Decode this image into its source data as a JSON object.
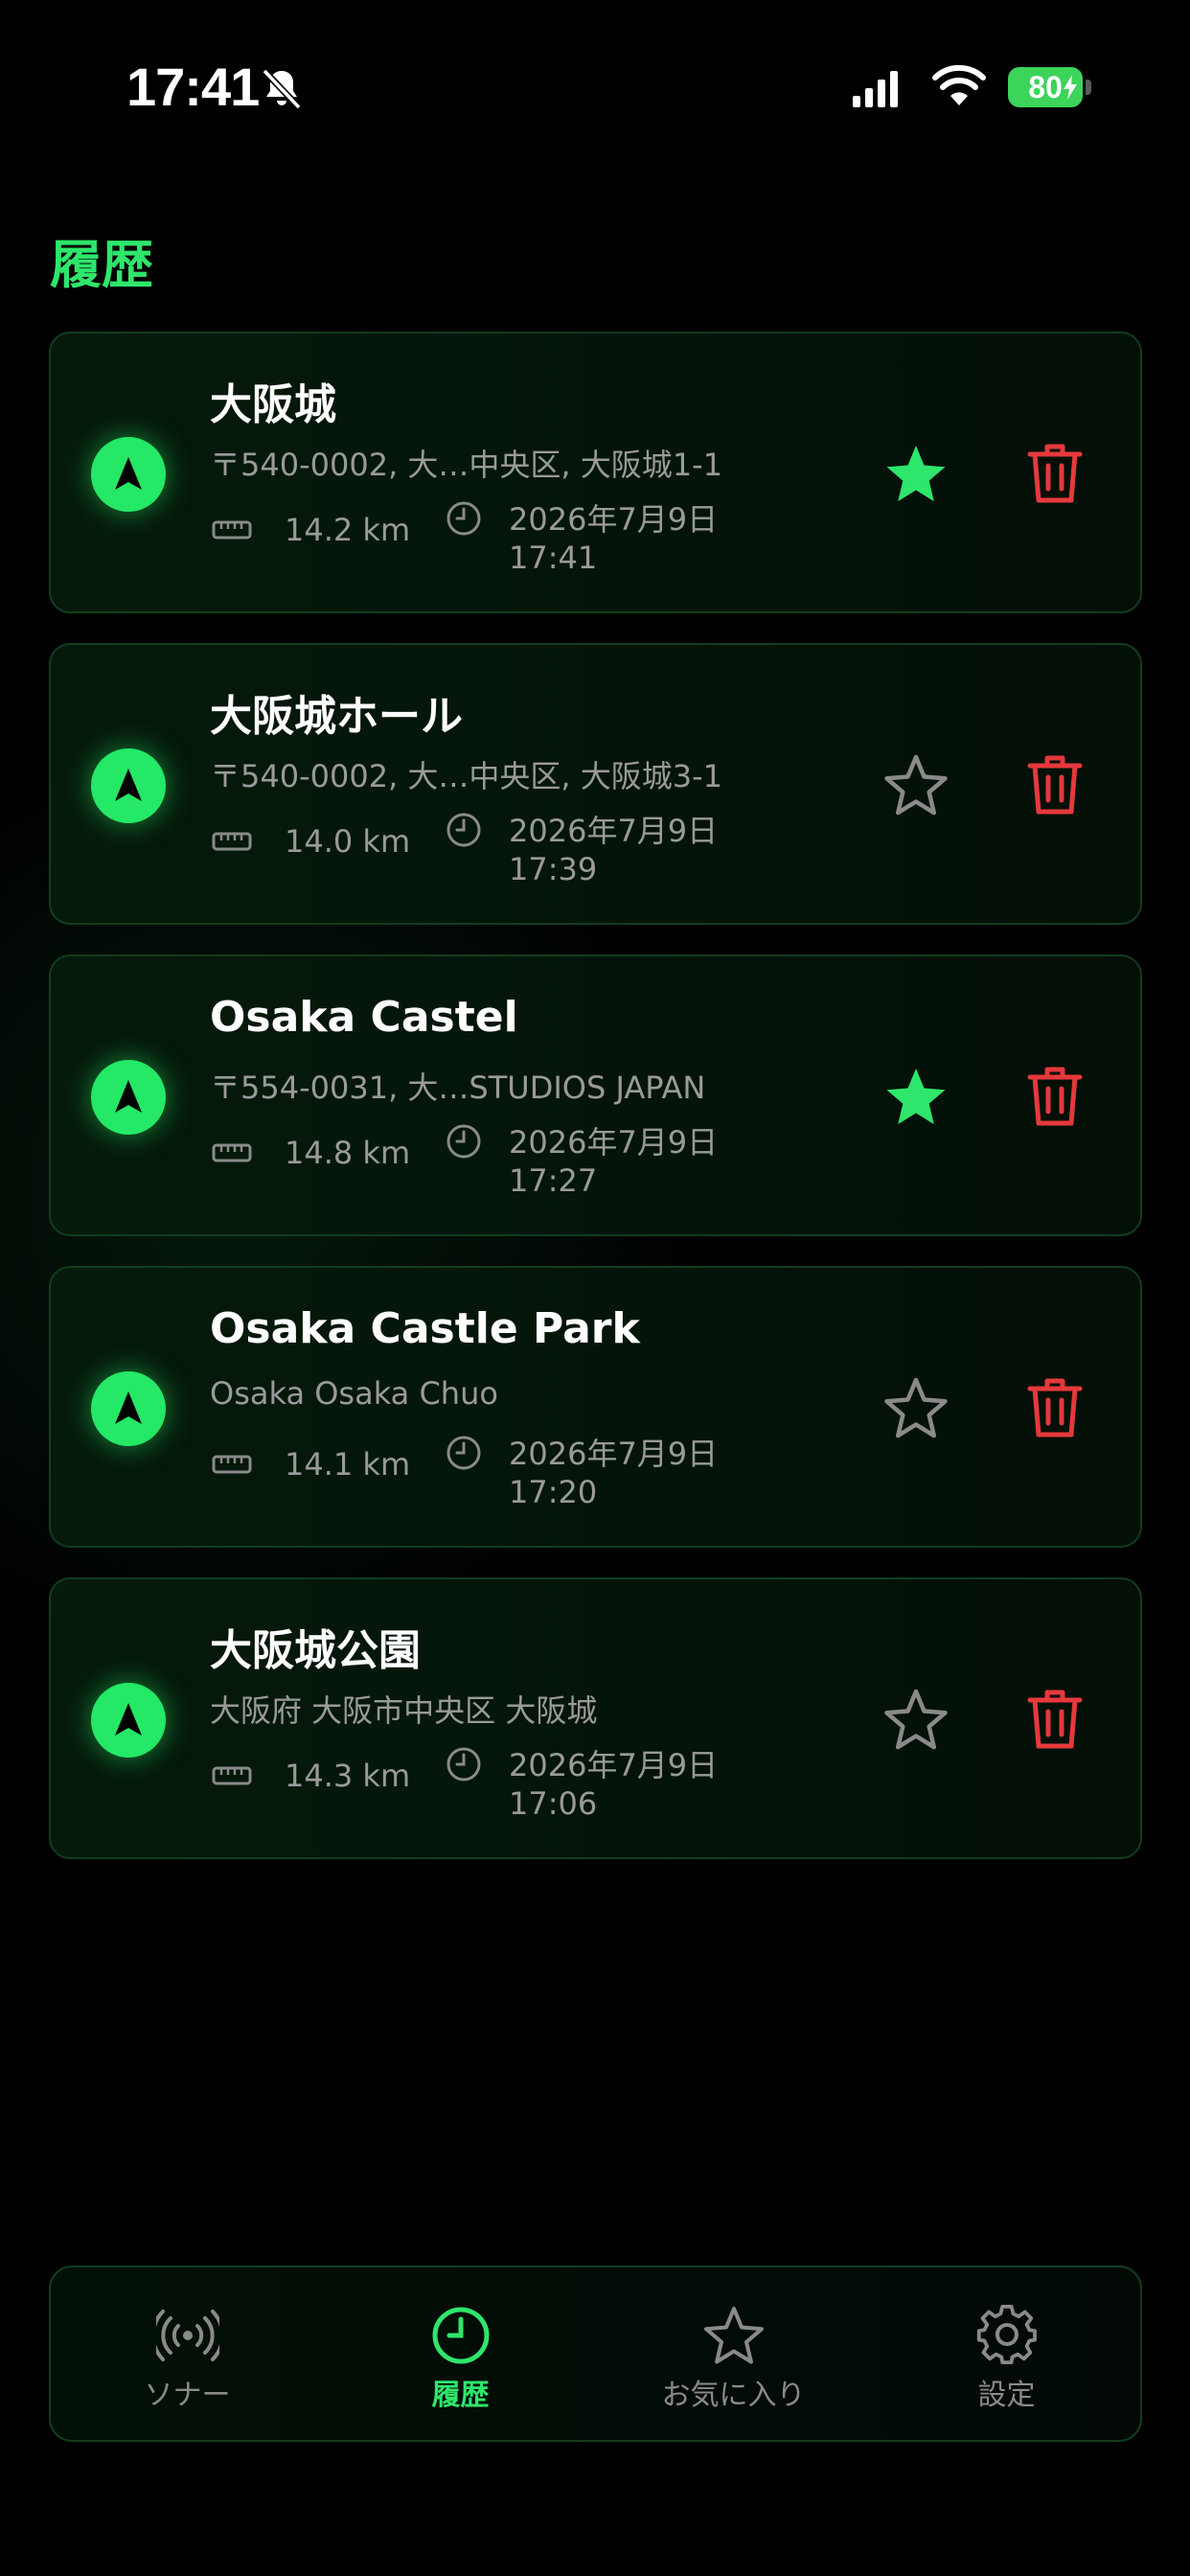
{
  "status_bar": {
    "time": "17:41",
    "battery": "80"
  },
  "page": {
    "title": "履歴"
  },
  "colors": {
    "accent": "#2ee66b",
    "delete": "#e5393c",
    "inactive": "#8a8a8a"
  },
  "history": [
    {
      "name": "大阪城",
      "address": "〒540-0002, 大…中央区, 大阪城1-1",
      "distance": "14.2 km",
      "date_line1": "2026年7月9日",
      "date_line2": "17:41",
      "favorite": true
    },
    {
      "name": "大阪城ホール",
      "address": "〒540-0002, 大…中央区, 大阪城3-1",
      "distance": "14.0 km",
      "date_line1": "2026年7月9日",
      "date_line2": "17:39",
      "favorite": false
    },
    {
      "name": "Osaka Castel",
      "address": "〒554-0031, 大…STUDIOS JAPAN",
      "distance": "14.8 km",
      "date_line1": "2026年7月9日",
      "date_line2": "17:27",
      "favorite": true
    },
    {
      "name": "Osaka Castle Park",
      "address": "Osaka Osaka Chuo",
      "distance": "14.1 km",
      "date_line1": "2026年7月9日",
      "date_line2": "17:20",
      "favorite": false
    },
    {
      "name": "大阪城公園",
      "address": "大阪府 大阪市中央区 大阪城",
      "distance": "14.3 km",
      "date_line1": "2026年7月9日",
      "date_line2": "17:06",
      "favorite": false
    }
  ],
  "tabs": [
    {
      "label": "ソナー",
      "icon": "sonar-icon",
      "active": false
    },
    {
      "label": "履歴",
      "icon": "clock-icon",
      "active": true
    },
    {
      "label": "お気に入り",
      "icon": "star-icon",
      "active": false
    },
    {
      "label": "設定",
      "icon": "gear-icon",
      "active": false
    }
  ]
}
